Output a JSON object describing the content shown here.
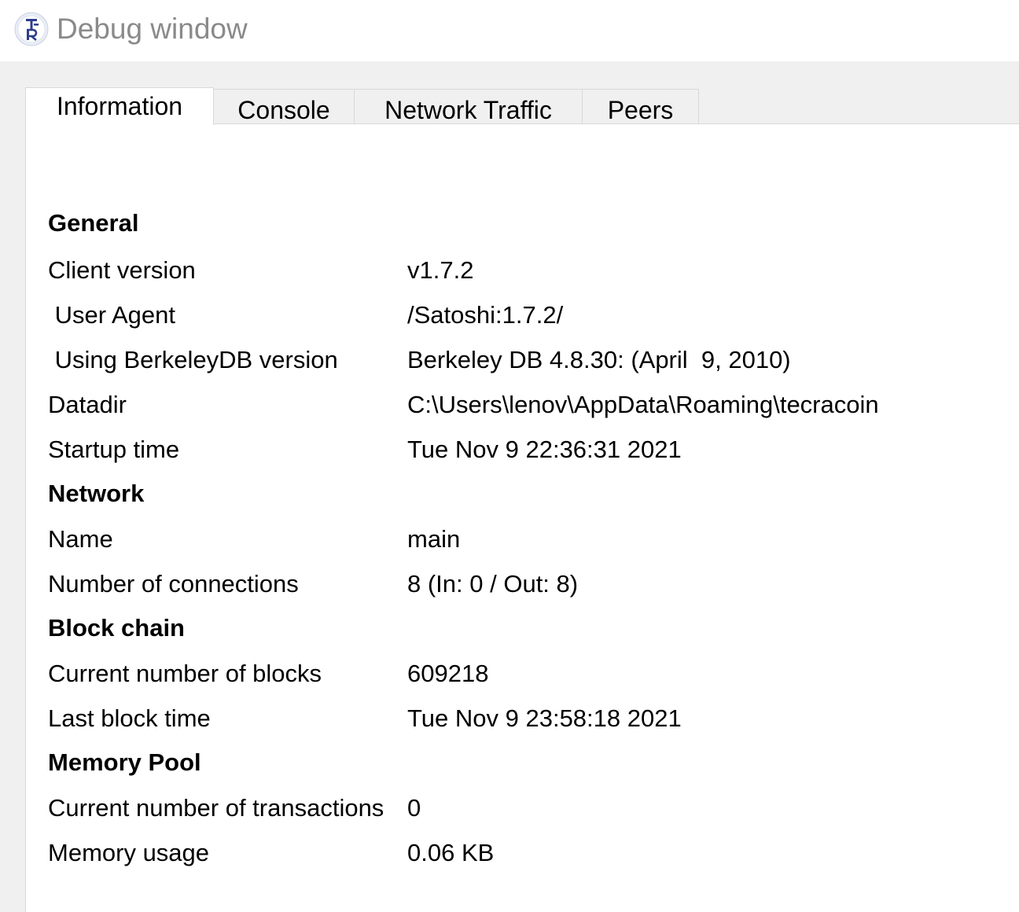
{
  "window": {
    "title": "Debug window",
    "icon": "tecracoin-logo-icon"
  },
  "tabs": [
    {
      "label": "Information",
      "active": true
    },
    {
      "label": "Console",
      "active": false
    },
    {
      "label": "Network Traffic",
      "active": false
    },
    {
      "label": "Peers",
      "active": false
    }
  ],
  "general": {
    "heading": "General",
    "client_version": {
      "label": "Client version",
      "value": "v1.7.2"
    },
    "user_agent": {
      "label": " User Agent",
      "value": "/Satoshi:1.7.2/"
    },
    "berkeleydb": {
      "label": " Using BerkeleyDB version",
      "value": "Berkeley DB 4.8.30: (April  9, 2010)"
    },
    "datadir": {
      "label": "Datadir",
      "value": "C:\\Users\\lenov\\AppData\\Roaming\\tecracoin"
    },
    "startup_time": {
      "label": "Startup time",
      "value": "Tue Nov 9 22:36:31 2021"
    }
  },
  "network": {
    "heading": "Network",
    "name": {
      "label": "Name",
      "value": "main"
    },
    "connections": {
      "label": "Number of connections",
      "value": "8 (In: 0 / Out: 8)"
    }
  },
  "blockchain": {
    "heading": "Block chain",
    "blocks": {
      "label": "Current number of blocks",
      "value": "609218"
    },
    "last_block_time": {
      "label": "Last block time",
      "value": "Tue Nov 9 23:58:18 2021"
    }
  },
  "mempool": {
    "heading": "Memory Pool",
    "transactions": {
      "label": "Current number of transactions",
      "value": "0"
    },
    "memory_usage": {
      "label": "Memory usage",
      "value": "0.06 KB"
    }
  }
}
